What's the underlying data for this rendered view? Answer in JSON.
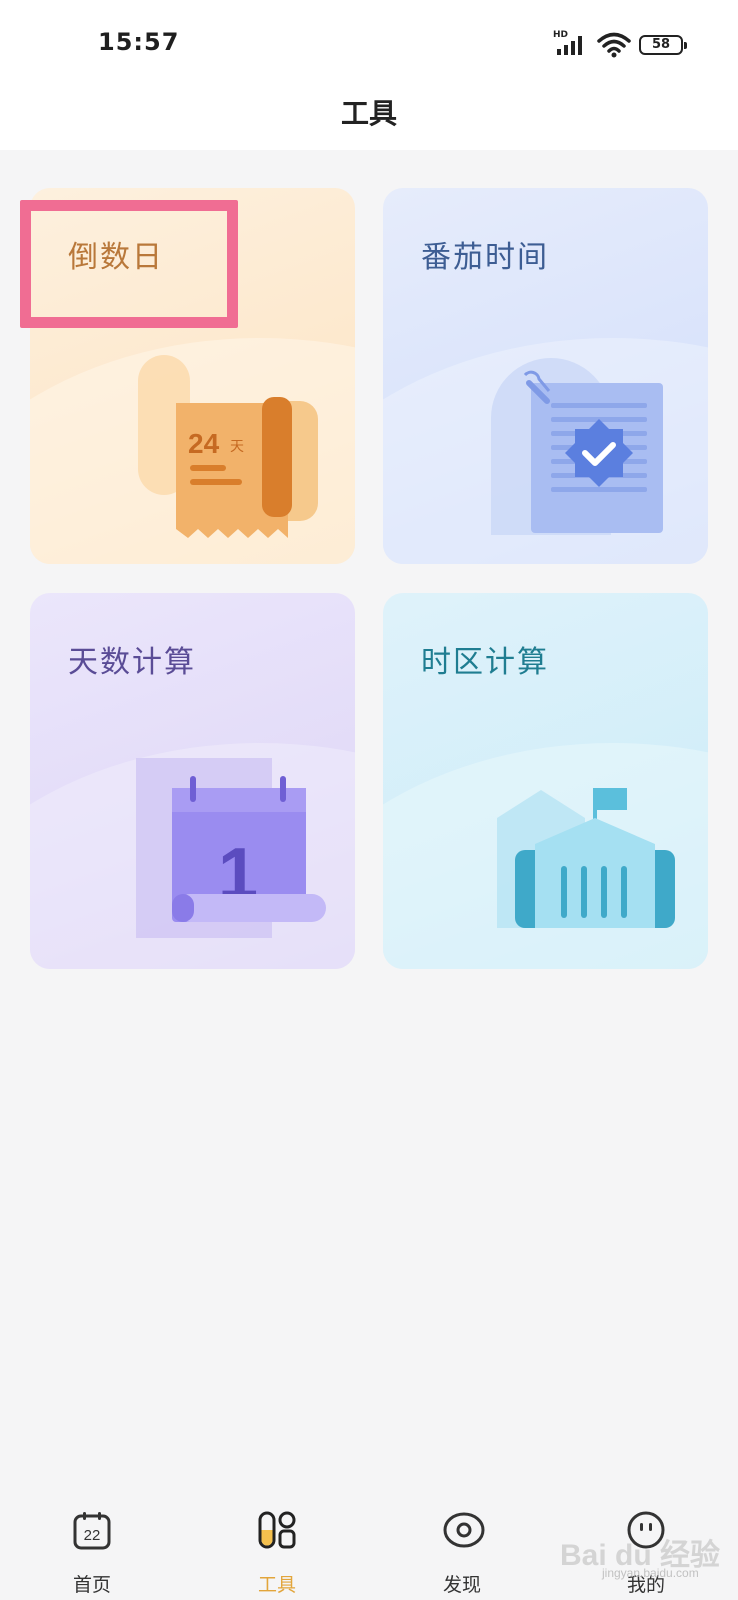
{
  "status_bar": {
    "time": "15:57",
    "network": "HD",
    "battery": "58"
  },
  "header": {
    "title": "工具"
  },
  "cards": [
    {
      "title": "倒数日",
      "illustration_text_number": "24",
      "illustration_text_unit": "天",
      "icon": "countdown-receipt-icon"
    },
    {
      "title": "番茄时间",
      "icon": "pomodoro-checklist-icon"
    },
    {
      "title": "天数计算",
      "illustration_text_number": "1",
      "icon": "calendar-icon"
    },
    {
      "title": "时区计算",
      "icon": "building-flag-icon"
    }
  ],
  "tabs": [
    {
      "label": "首页",
      "icon": "calendar-22-icon",
      "icon_text": "22"
    },
    {
      "label": "工具",
      "icon": "tools-grid-icon",
      "active": true
    },
    {
      "label": "发现",
      "icon": "eye-icon"
    },
    {
      "label": "我的",
      "icon": "smile-icon"
    }
  ],
  "watermark": {
    "text": "Bai du 经验",
    "sub": "jingyan.baidu.com"
  },
  "colors": {
    "active_tab": "#e2a53b",
    "highlight": "#f06d93"
  }
}
